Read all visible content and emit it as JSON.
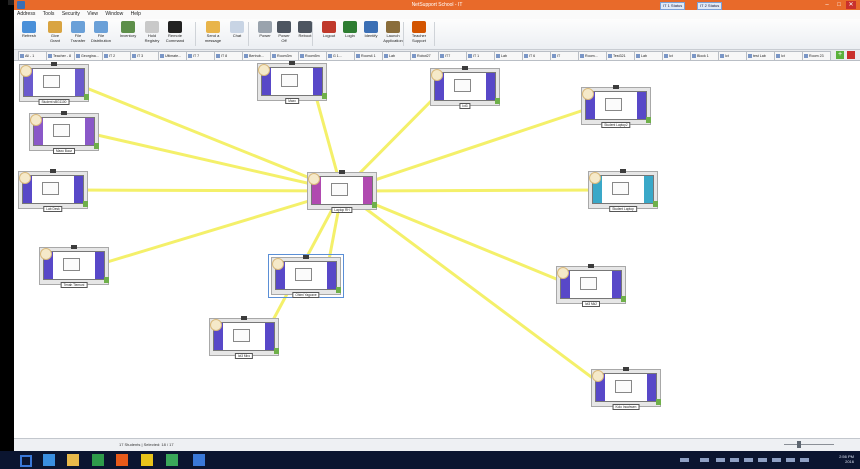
{
  "window": {
    "title": "NetSupport School - IT",
    "title_buttons": [
      "IT 1 Status",
      "IT 2 Status"
    ],
    "controls": {
      "minimize": "–",
      "maximize": "□",
      "close": "✕"
    }
  },
  "menu": [
    "Address",
    "Tools",
    "Security",
    "View",
    "Window",
    "Help"
  ],
  "ribbon": {
    "buttons": [
      {
        "label": "Refresh",
        "label2": "",
        "icon": "refresh-icon",
        "color": "#4a90d9"
      },
      {
        "label": "Give",
        "label2": "Grant",
        "icon": "give-icon",
        "color": "#d9a441"
      },
      {
        "label": "File",
        "label2": "Transfer",
        "icon": "file-transfer-icon",
        "color": "#6aa0d8"
      },
      {
        "label": "File",
        "label2": "Distribution",
        "icon": "file-distribution-icon",
        "color": "#6aa0d8"
      },
      {
        "label": "Inventory",
        "label2": "",
        "icon": "inventory-icon",
        "color": "#5d8f4a"
      },
      {
        "label": "Hold",
        "label2": "Registry",
        "icon": "hold-icon",
        "color": "#c9c9c9"
      },
      {
        "label": "Remote",
        "label2": "Command",
        "icon": "remote-command-icon",
        "color": "#222222"
      },
      {
        "label": "Send a",
        "label2": "message",
        "icon": "message-icon",
        "color": "#e8b44a"
      },
      {
        "label": "Chat",
        "label2": "",
        "icon": "chat-icon",
        "color": "#c8d4e4"
      },
      {
        "label": "Power",
        "label2": "",
        "icon": "power-icon",
        "color": "#9aa3ad"
      },
      {
        "label": "Power",
        "label2": "Off",
        "icon": "power-off-icon",
        "color": "#4d5560"
      },
      {
        "label": "Reboot",
        "label2": "",
        "icon": "reboot-icon",
        "color": "#4d5560"
      },
      {
        "label": "Logout",
        "label2": "",
        "icon": "logout-icon",
        "color": "#c0392b"
      },
      {
        "label": "Login",
        "label2": "",
        "icon": "login-icon",
        "color": "#2e7d32"
      },
      {
        "label": "Identify",
        "label2": "",
        "icon": "identify-icon",
        "color": "#3b6fb5"
      },
      {
        "label": "Launch",
        "label2": "Application",
        "icon": "launch-icon",
        "color": "#8a6d3b"
      },
      {
        "label": "Teacher",
        "label2": "Support",
        "icon": "teacher-support-icon",
        "color": "#d35400"
      }
    ]
  },
  "tabs": [
    "All - 1",
    "Teacher - 8",
    "Georgina...",
    "IT 2",
    "IT 3",
    "Ultimate...",
    "IT 7",
    "IT 8",
    "Bertrub...",
    "Room3m",
    "Room5m",
    "G 1...",
    "Room4 1",
    "Lab",
    "Robot27",
    "IT7",
    "IT 1",
    "Lab",
    "IT 6",
    "IT",
    "Room...",
    "Test321",
    "Lab",
    "Ict",
    "Block 1",
    "Ict",
    "test Lab",
    "Ict",
    "Room 23"
  ],
  "thumbnails": [
    {
      "label": "Student sBG1100",
      "bar_color": "#6a5acd"
    },
    {
      "label": "Maxx",
      "bar_color": "#5848c8"
    },
    {
      "label": "Ict3",
      "bar_color": "#5848c8"
    },
    {
      "label": "Student Laptop2",
      "bar_color": "#5848c8"
    },
    {
      "label": "Maxo Buoz",
      "bar_color": "#8a58c8"
    },
    {
      "label": "Laptop RH",
      "bar_color": "#b04ab0"
    },
    {
      "label": "Lab Desk",
      "bar_color": "#5848c8"
    },
    {
      "label": "Student Laptop",
      "bar_color": "#3aa8c8"
    },
    {
      "label": "Tenah Tiemuni",
      "bar_color": "#5848c8"
    },
    {
      "label": "Ohimi Yagozxe",
      "bar_color": "#5848c8"
    },
    {
      "label": "Ict3 Mk2",
      "bar_color": "#5848c8"
    },
    {
      "label": "Ict3 Miro",
      "bar_color": "#5848c8"
    },
    {
      "label": "Kolo Incahwen",
      "bar_color": "#5848c8"
    }
  ],
  "status": {
    "text": "17 Students  |  Selected: 18 / 17"
  },
  "zoom": {
    "level": 0.3
  },
  "taskbar": {
    "apps": [
      {
        "icon": "start-icon",
        "color": "#3a78d8"
      },
      {
        "icon": "ie-icon",
        "color": "#3a8fe0"
      },
      {
        "icon": "explorer-icon",
        "color": "#e8b94a"
      },
      {
        "icon": "green-app-icon",
        "color": "#2e9b4a"
      },
      {
        "icon": "outlook-icon",
        "color": "#e85a1a"
      },
      {
        "icon": "chrome-icon",
        "color": "#e8c31a"
      },
      {
        "icon": "vine-icon",
        "color": "#3aa85a"
      },
      {
        "icon": "netsupport-icon",
        "color": "#3a78d8"
      }
    ],
    "clock": {
      "time": "2:56 PM",
      "date": "2016"
    }
  }
}
